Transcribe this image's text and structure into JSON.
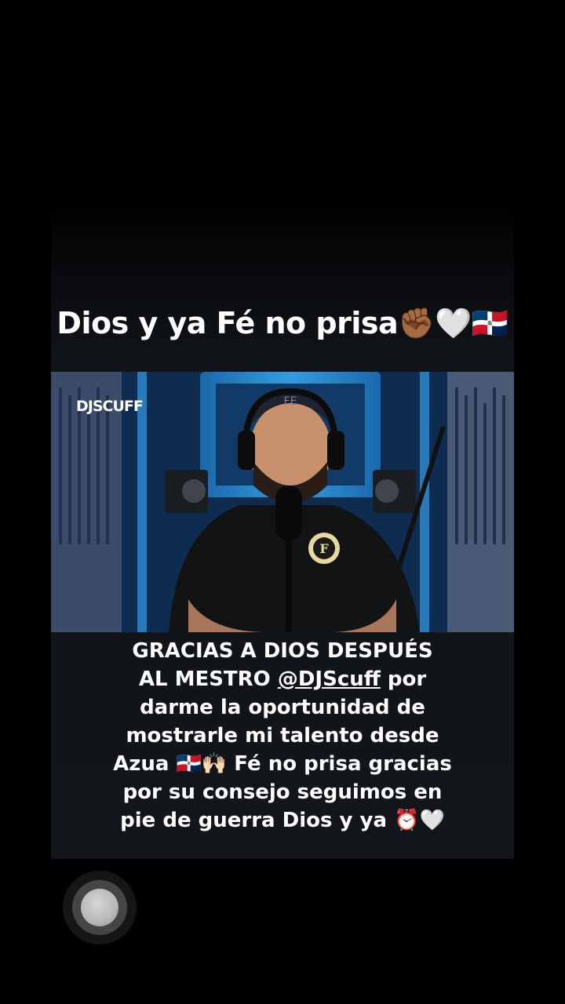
{
  "post": {
    "overlay_title": "Dios y ya Fé no prisa✊🏾🤍🇩🇴",
    "video": {
      "watermark": "DJSCUFF",
      "cap_text": "FE",
      "badge_letter": "F"
    },
    "caption": {
      "line1": "GRACIAS A DIOS DESPUÉS",
      "prefix": "AL MESTRO ",
      "mention": "@DJScuff",
      "suffix": " por darme la oportunidad de mostrarle mi talento desde Azua 🇩🇴🙌🏻 Fé no prisa gracias por su consejo seguimos en pie de guerra Dios y ya ⏰🤍"
    }
  },
  "colors": {
    "background": "#000000",
    "caption_text": "#ffffff",
    "studio_light": "#3aa8f0"
  }
}
